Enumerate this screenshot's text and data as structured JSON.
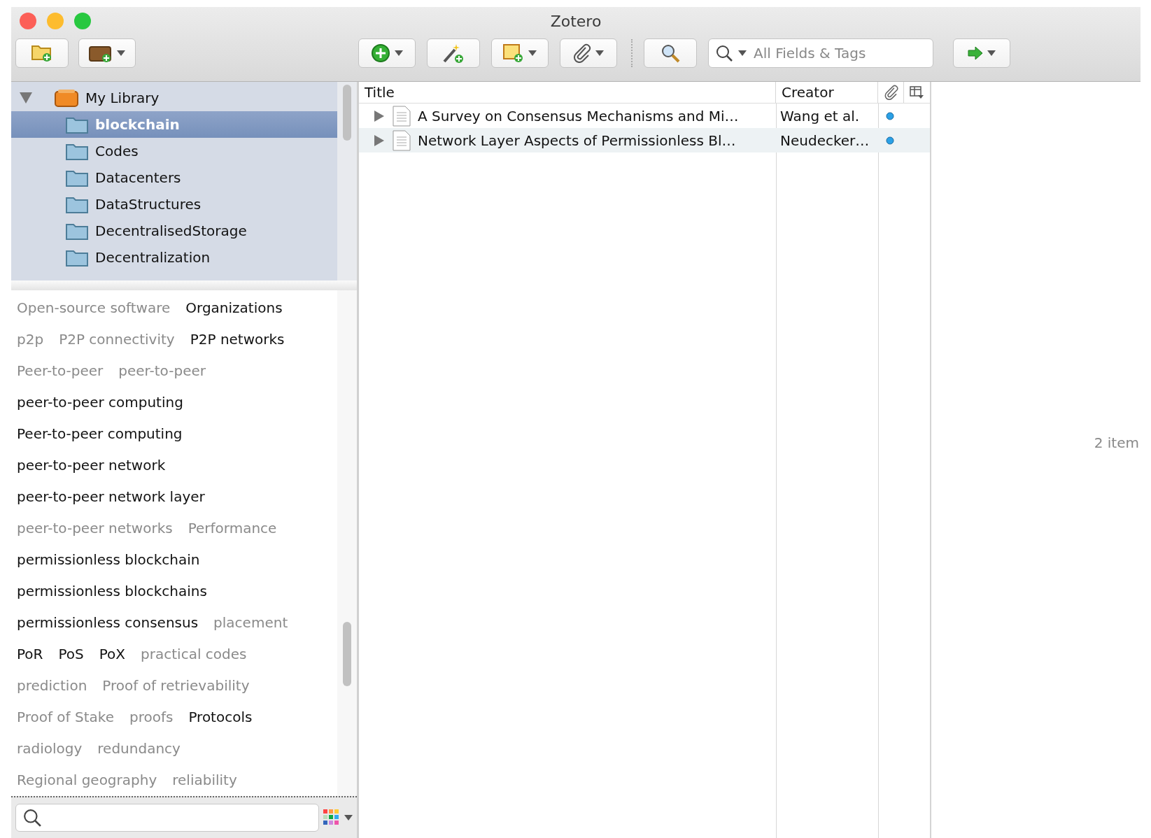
{
  "window": {
    "title": "Zotero"
  },
  "toolbar": {
    "search": {
      "placeholder": "All Fields & Tags"
    }
  },
  "collections": [
    {
      "label": "My Library",
      "kind": "library",
      "expanded": true,
      "selected": false,
      "children": [
        {
          "label": "blockchain",
          "kind": "folder",
          "selected": true
        },
        {
          "label": "Codes",
          "kind": "folder",
          "selected": false
        },
        {
          "label": "Datacenters",
          "kind": "folder",
          "selected": false
        },
        {
          "label": "DataStructures",
          "kind": "folder",
          "selected": false
        },
        {
          "label": "DecentralisedStorage",
          "kind": "folder",
          "selected": false
        },
        {
          "label": "Decentralization",
          "kind": "folder",
          "selected": false
        }
      ]
    }
  ],
  "tag_rows": [
    {
      "tags": [
        {
          "label": "Open-source software",
          "disabled": true
        },
        {
          "label": "Organizations",
          "disabled": false
        }
      ]
    },
    {
      "tags": [
        {
          "label": "p2p",
          "disabled": true
        },
        {
          "label": "P2P connectivity",
          "disabled": true
        },
        {
          "label": "P2P networks",
          "disabled": false
        }
      ]
    },
    {
      "tags": [
        {
          "label": "Peer-to-peer",
          "disabled": true
        },
        {
          "label": "peer-to-peer",
          "disabled": true
        }
      ]
    },
    {
      "tags": [
        {
          "label": "peer-to-peer computing",
          "disabled": false
        }
      ]
    },
    {
      "tags": [
        {
          "label": "Peer-to-peer computing",
          "disabled": false
        }
      ]
    },
    {
      "tags": [
        {
          "label": "peer-to-peer network",
          "disabled": false
        }
      ]
    },
    {
      "tags": [
        {
          "label": "peer-to-peer network layer",
          "disabled": false
        }
      ]
    },
    {
      "tags": [
        {
          "label": "peer-to-peer networks",
          "disabled": true
        },
        {
          "label": "Performance",
          "disabled": true
        }
      ]
    },
    {
      "tags": [
        {
          "label": "permissionless blockchain",
          "disabled": false
        }
      ]
    },
    {
      "tags": [
        {
          "label": "permissionless blockchains",
          "disabled": false
        }
      ]
    },
    {
      "tags": [
        {
          "label": "permissionless consensus",
          "disabled": false
        },
        {
          "label": "placement",
          "disabled": true
        }
      ]
    },
    {
      "tags": [
        {
          "label": "PoR",
          "disabled": false
        },
        {
          "label": "PoS",
          "disabled": false
        },
        {
          "label": "PoX",
          "disabled": false
        },
        {
          "label": "practical codes",
          "disabled": true
        }
      ]
    },
    {
      "tags": [
        {
          "label": "prediction",
          "disabled": true
        },
        {
          "label": "Proof of retrievability",
          "disabled": true
        }
      ]
    },
    {
      "tags": [
        {
          "label": "Proof of Stake",
          "disabled": true
        },
        {
          "label": "proofs",
          "disabled": true
        },
        {
          "label": "Protocols",
          "disabled": false
        }
      ]
    },
    {
      "tags": [
        {
          "label": "radiology",
          "disabled": true
        },
        {
          "label": "redundancy",
          "disabled": true
        }
      ]
    },
    {
      "tags": [
        {
          "label": "Regional geography",
          "disabled": true
        },
        {
          "label": "reliability",
          "disabled": true
        }
      ]
    }
  ],
  "items": {
    "columns": [
      "Title",
      "Creator"
    ],
    "rows": [
      {
        "title": "A Survey on Consensus Mechanisms and Mi…",
        "creator": "Wang et al."
      },
      {
        "title": "Network Layer Aspects of Permissionless Bl…",
        "creator": "Neudecker…"
      }
    ]
  },
  "item_pane": {
    "count": "2 item"
  }
}
